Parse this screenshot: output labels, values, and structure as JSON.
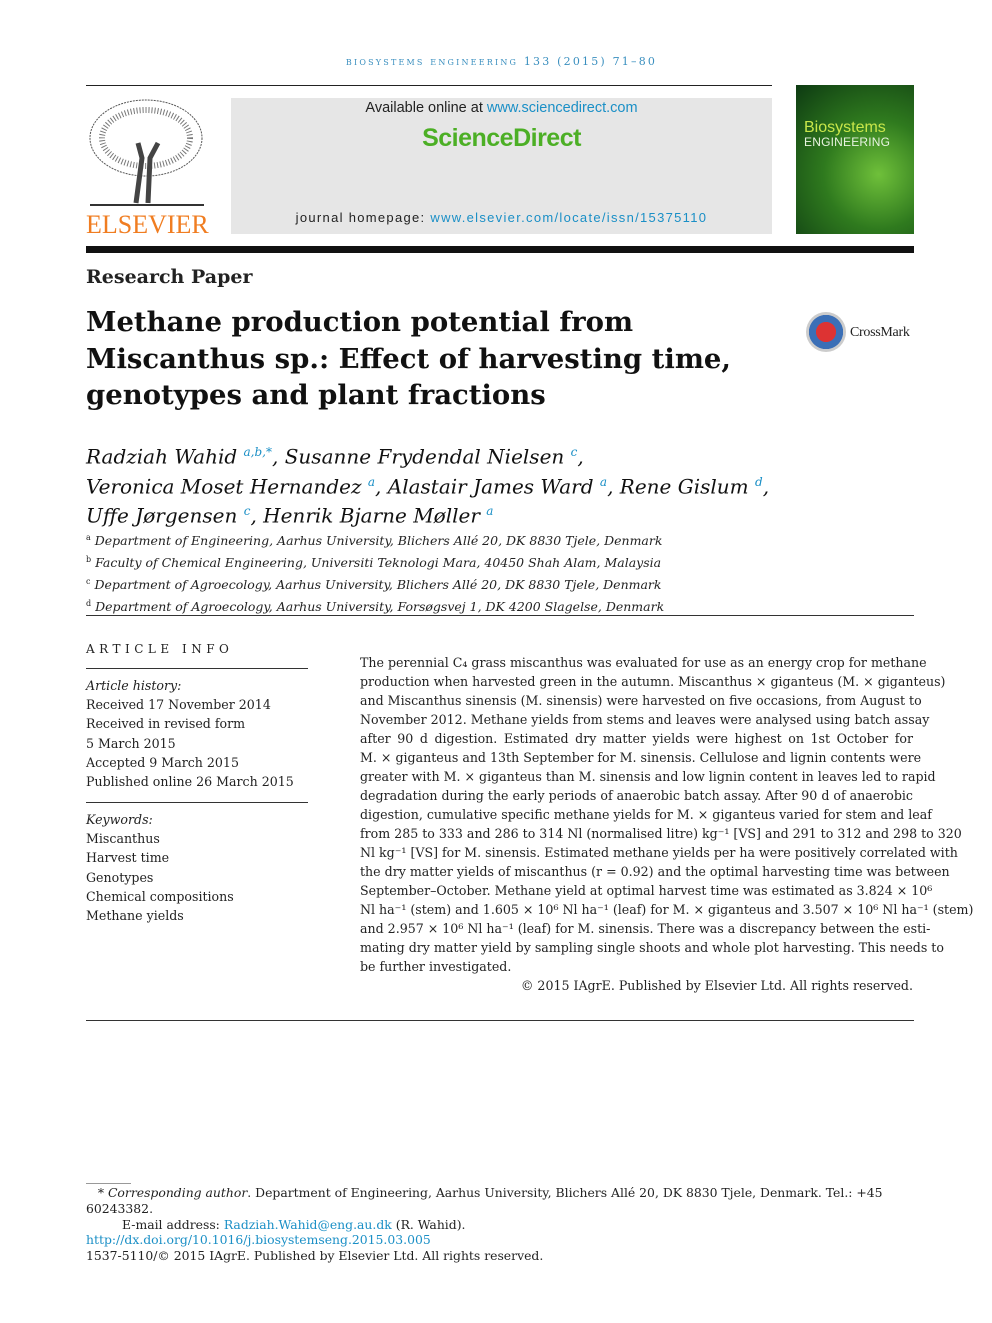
{
  "running_header": "biosystems engineering 133 (2015) 71–80",
  "header": {
    "publisher_logo": "ELSEVIER",
    "available_prefix": "Available online at ",
    "available_link": "www.sciencedirect.com",
    "sciencedirect_logo": "ScienceDirect",
    "homepage_prefix": "journal homepage: ",
    "homepage_link": "www.elsevier.com/locate/issn/15375110",
    "cover_title_1": "Biosystems",
    "cover_title_2": "ENGINEERING"
  },
  "paper_type": "Research Paper",
  "title": "Methane production potential from Miscanthus sp.: Effect of harvesting time, genotypes and plant fractions",
  "crossmark": "CrossMark",
  "authors": [
    {
      "name": "Radziah Wahid",
      "aff": "a,b,*",
      "sep": ", "
    },
    {
      "name": "Susanne Frydendal Nielsen",
      "aff": "c",
      "sep": ","
    },
    {
      "name": "Veronica Moset Hernandez",
      "aff": "a",
      "sep": ", "
    },
    {
      "name": "Alastair James Ward",
      "aff": "a",
      "sep": ", "
    },
    {
      "name": "Rene Gislum",
      "aff": "d",
      "sep": ","
    },
    {
      "name": "Uffe Jørgensen",
      "aff": "c",
      "sep": ", "
    },
    {
      "name": "Henrik Bjarne Møller",
      "aff": "a",
      "sep": ""
    }
  ],
  "affiliations": [
    {
      "key": "a",
      "text": "Department of Engineering, Aarhus University, Blichers Allé 20, DK 8830 Tjele, Denmark"
    },
    {
      "key": "b",
      "text": "Faculty of Chemical Engineering, Universiti Teknologi Mara, 40450 Shah Alam, Malaysia"
    },
    {
      "key": "c",
      "text": "Department of Agroecology, Aarhus University, Blichers Allé 20, DK 8830 Tjele, Denmark"
    },
    {
      "key": "d",
      "text": "Department of Agroecology, Aarhus University, Forsøgsvej 1, DK 4200 Slagelse, Denmark"
    }
  ],
  "article_info": {
    "heading": "ARTICLE INFO",
    "history_label": "Article history:",
    "history": [
      "Received 17 November 2014",
      "Received in revised form",
      "5 March 2015",
      "Accepted 9 March 2015",
      "Published online 26 March 2015"
    ],
    "keywords_label": "Keywords:",
    "keywords": [
      "Miscanthus",
      "Harvest time",
      "Genotypes",
      "Chemical compositions",
      "Methane yields"
    ]
  },
  "abstract_lines": [
    "The perennial C₄ grass miscanthus was evaluated for use as an energy crop for methane",
    "production when harvested green in the autumn. Miscanthus × giganteus (M. × giganteus)",
    "and Miscanthus sinensis (M. sinensis) were harvested on five occasions, from August to",
    "November 2012. Methane yields from stems and leaves were analysed using batch assay",
    "after 90 d digestion. Estimated dry matter yields were highest on 1st October for",
    "M. × giganteus and 13th September for M. sinensis. Cellulose and lignin contents were",
    "greater with M. × giganteus than M. sinensis and low lignin content in leaves led to rapid",
    "degradation during the early periods of anaerobic batch assay. After 90 d of anaerobic",
    "digestion, cumulative specific methane yields for M. × giganteus varied for stem and leaf",
    "from 285 to 333 and 286 to 314 Nl (normalised litre) kg⁻¹ [VS] and 291 to 312 and 298 to 320",
    "Nl kg⁻¹ [VS] for M. sinensis. Estimated methane yields per ha were positively correlated with",
    "the dry matter yields of miscanthus (r = 0.92) and the optimal harvesting time was between",
    "September–October. Methane yield at optimal harvest time was estimated as 3.824 × 10⁶",
    "Nl ha⁻¹ (stem) and 1.605 × 10⁶ Nl ha⁻¹ (leaf) for M. × giganteus and 3.507 × 10⁶ Nl ha⁻¹ (stem)",
    "and 2.957 × 10⁶ Nl ha⁻¹ (leaf) for M. sinensis. There was a discrepancy between the esti-",
    "mating dry matter yield by sampling single shoots and whole plot harvesting. This needs to",
    "be further investigated."
  ],
  "abstract_copyright": "© 2015 IAgrE. Published by Elsevier Ltd. All rights reserved.",
  "footnotes": {
    "corresponding_label": "Corresponding author",
    "corresponding_text": ". Department of Engineering, Aarhus University, Blichers Allé 20, DK 8830 Tjele, Denmark. Tel.: +45 60243382.",
    "email_label": "E-mail address: ",
    "email": "Radziah.Wahid@eng.au.dk",
    "email_suffix": " (R. Wahid).",
    "doi": "http://dx.doi.org/10.1016/j.biosystemseng.2015.03.005",
    "issn_line": "1537-5110/© 2015 IAgrE. Published by Elsevier Ltd. All rights reserved."
  }
}
